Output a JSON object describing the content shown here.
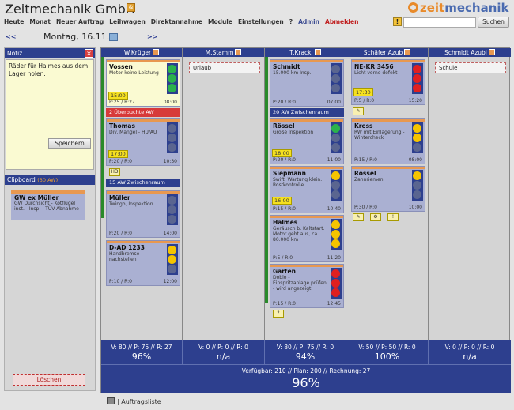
{
  "app": {
    "title": "Zeitmechanik GmbH",
    "badge": "&",
    "logo_a": "zeit",
    "logo_b": "mechanik"
  },
  "menu": [
    "Heute",
    "Monat",
    "Neuer Auftrag",
    "Leihwagen",
    "Direktannahme",
    "Module",
    "Einstellungen",
    "?",
    "Admin",
    "Abmelden"
  ],
  "search": {
    "value": "",
    "button": "Suchen"
  },
  "nav": {
    "prev": "<<",
    "date": "Montag, 16.11.",
    "next": ">>"
  },
  "note": {
    "title": "Notiz",
    "text": "Räder für Halmes aus dem Lager holen.",
    "save": "Speichern"
  },
  "clipboard": {
    "title": "Clipboard",
    "aw": "(30 AW)",
    "card_name": "GW ex Müller",
    "card_desc": "GW Durchsicht - Kotflügel inst. - Insp. - TÜV-Abnahme",
    "delete": "Löschen"
  },
  "columns": [
    {
      "name": "W.Krüger",
      "stats": "V: 80 // P: 75 // R: 27",
      "pct": "96%"
    },
    {
      "name": "M.Stamm",
      "stats": "V: 0 // P: 0 // R: 0",
      "pct": "n/a",
      "note": "Urlaub"
    },
    {
      "name": "T.Krackl",
      "stats": "V: 80 // P: 75 // R: 0",
      "pct": "94%"
    },
    {
      "name": "Schäfer Azub",
      "stats": "V: 50 // P: 50 // R: 0",
      "pct": "100%"
    },
    {
      "name": "Schmidt Azubi",
      "stats": "V: 0 // P: 0 // R: 0",
      "pct": "n/a",
      "note": "Schule"
    }
  ],
  "cards": {
    "vossen": {
      "name": "Vossen",
      "desc": "Motor keine Leistung",
      "time": "15:00",
      "foot_l": "P:25 / R:27",
      "foot_r": "08:00"
    },
    "vossen_strip": "2 Überbuchte AW",
    "thomas": {
      "name": "Thomas",
      "desc": "Div. Mängel - HU/AU",
      "time": "17:00",
      "foot_l": "P:20 / R:0",
      "foot_r": "10:30"
    },
    "thomas_strip": "15 AW Zwischenraum",
    "mueller": {
      "name": "Müller",
      "desc": "Twingo, Inspektion",
      "foot_l": "P:20 / R:0",
      "foot_r": "14:00"
    },
    "dad": {
      "name": "D-AD 1233",
      "desc": "Handbremse nachstellen",
      "foot_l": "P:10 / R:0",
      "foot_r": "12:00"
    },
    "schmidt": {
      "name": "Schmidt",
      "desc": "15.000 km Insp.",
      "foot_l": "P:20 / R:0",
      "foot_r": "07:00"
    },
    "schmidt_strip": "20 AW Zwischenraum",
    "roessel1": {
      "name": "Rössel",
      "desc": "Große Inspektion",
      "time": "18:00",
      "foot_l": "P:20 / R:0",
      "foot_r": "11:00"
    },
    "siepmann": {
      "name": "Siepmann",
      "desc": "Swift. Wartung klein. Rostkontrolle",
      "time": "16:00",
      "foot_l": "P:15 / R:0",
      "foot_r": "10:40"
    },
    "halmes": {
      "name": "Halmes",
      "desc": "Geräusch b. Kaltstart. Motor geht aus, ca. 80.000 km",
      "foot_l": "P:5 / R:0",
      "foot_r": "11:20"
    },
    "garten": {
      "name": "Garten",
      "desc": "Doblo - Einspritzanlage prüfen - wird angezeigt",
      "foot_l": "P:15 / R:0",
      "foot_r": "12:45"
    },
    "nekr": {
      "name": "NE-KR 3456",
      "desc": "Licht vorne defekt",
      "time": "17:30",
      "foot_l": "P:5 / R:0",
      "foot_r": "15:20"
    },
    "kress": {
      "name": "Kress",
      "desc": "RW mit Einlagerung - Wintercheck",
      "foot_l": "P:15 / R:0",
      "foot_r": "08:00"
    },
    "roessel2": {
      "name": "Rössel",
      "desc": "Zahnriemen",
      "foot_l": "P:30 / R:0",
      "foot_r": "10:00"
    }
  },
  "total": {
    "line": "Verfügbar: 210 // Plan: 200 // Rechnung: 27",
    "pct": "96%"
  },
  "footer": {
    "link": "| Auftragsliste"
  }
}
